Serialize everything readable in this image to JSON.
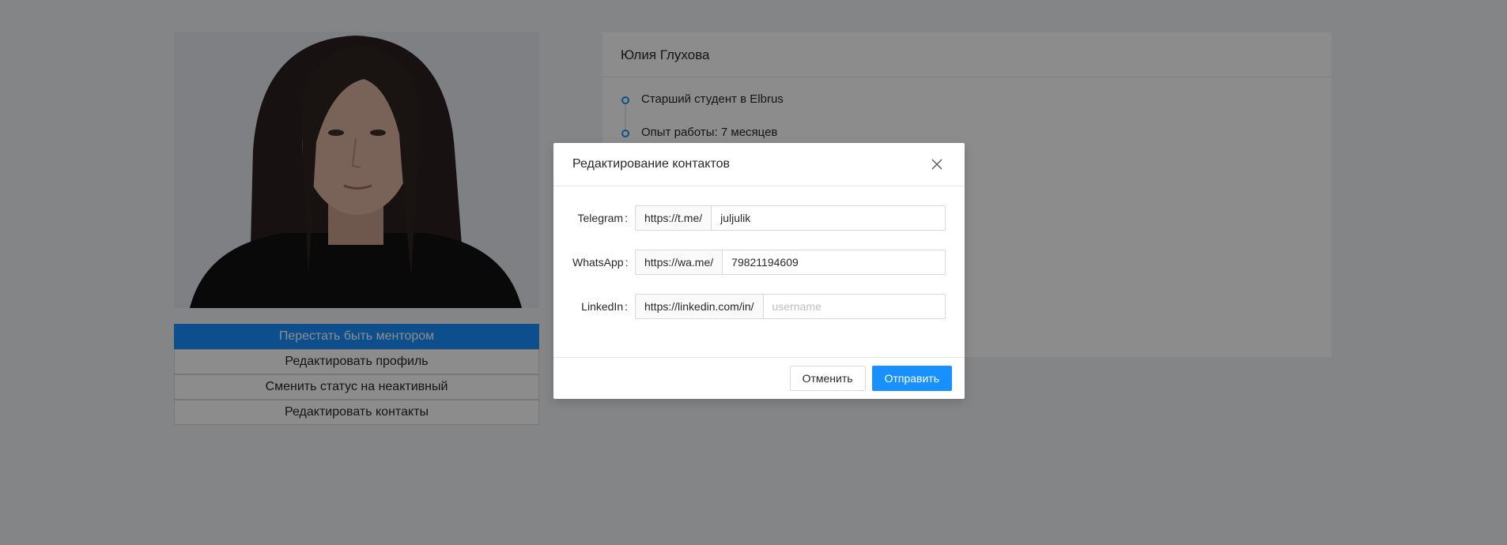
{
  "profile": {
    "name": "Юлия Глухова",
    "timeline": [
      "Старший студент в Elbrus",
      "Опыт работы: 7 месяцев"
    ],
    "actions": [
      "Перестать быть ментором",
      "Редактировать профиль",
      "Сменить статус на неактивный",
      "Редактировать контакты"
    ]
  },
  "modal": {
    "title": "Редактирование контактов",
    "close_icon": "close-icon",
    "fields": [
      {
        "label": "Telegram",
        "prefix": "https://t.me/",
        "value": "juljulik",
        "placeholder": ""
      },
      {
        "label": "WhatsApp",
        "prefix": "https://wa.me/",
        "value": "79821194609",
        "placeholder": ""
      },
      {
        "label": "LinkedIn",
        "prefix": "https://linkedin.com/in/",
        "value": "",
        "placeholder": "username"
      }
    ],
    "cancel_label": "Отменить",
    "submit_label": "Отправить"
  },
  "colors": {
    "primary": "#1890ff",
    "mask": "rgba(0,0,0,0.45)"
  }
}
